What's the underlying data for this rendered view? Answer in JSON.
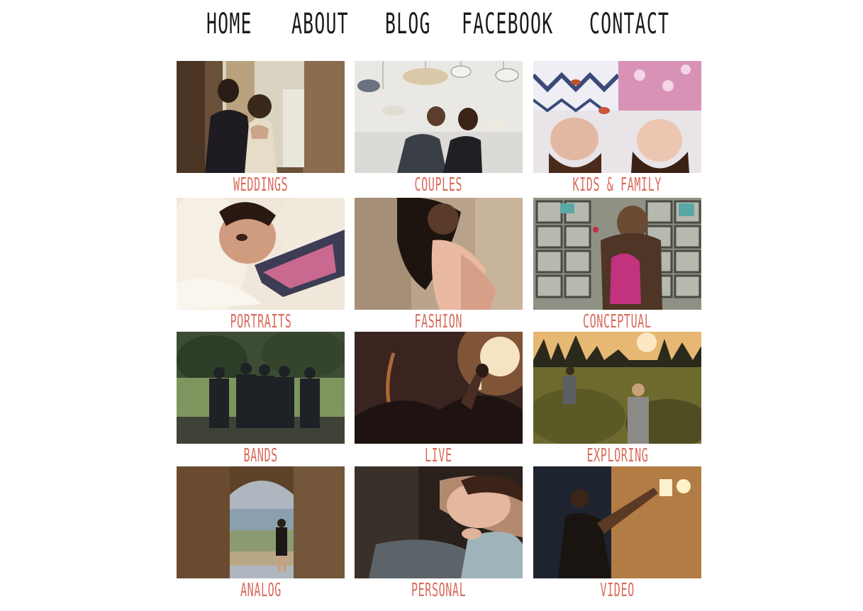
{
  "nav": {
    "home": "HOME",
    "about": "ABOUT",
    "blog": "BLOG",
    "facebook": "FACEBOOK",
    "contact": "CONTACT"
  },
  "gallery": [
    {
      "label": "WEDDINGS"
    },
    {
      "label": "COUPLES"
    },
    {
      "label": "KIDS & FAMILY"
    },
    {
      "label": "PORTRAITS"
    },
    {
      "label": "FASHION"
    },
    {
      "label": "CONCEPTUAL"
    },
    {
      "label": "BANDS"
    },
    {
      "label": "LIVE"
    },
    {
      "label": "EXPLORING"
    },
    {
      "label": "ANALOG"
    },
    {
      "label": "PERSONAL"
    },
    {
      "label": "VIDEO"
    }
  ],
  "colors": {
    "nav_text": "#1a1a1a",
    "caption_text": "#d9695a",
    "background": "#ffffff"
  }
}
